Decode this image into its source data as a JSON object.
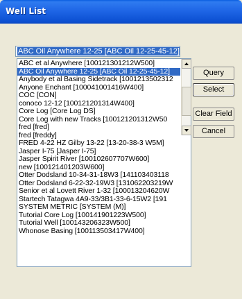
{
  "window": {
    "title": "Well List"
  },
  "selected_text": "ABC Oil Anywhere 12-25  [ABC Oil 12-25-45-12]",
  "list": {
    "items": [
      "ABC et al Anywhere  [100121301212W500]",
      "ABC Oil Anywhere 12-25  [ABC Oil 12-25-45-12]",
      "Anybody et al Basing Sidetrack  [1001213502312",
      "Anyone Enchant  [100041001416W400]",
      "COC  [CON]",
      "conoco 12-12  [100121201314W400]",
      "Core Log  [Core Log DS]",
      "Core Log with new Tracks  [100121201312W50",
      "fred  [fred]",
      "fred  [freddy]",
      "FRED 4-22 HZ Gilby 13-22  [13-20-38-3 W5M]",
      "Jasper I-75  [Jasper I-75]",
      "Jasper Spirit River  [100102607707W600]",
      "new  [100121401203W600]",
      "Otter Dodsland 10-34-31-18W3  [141103403118",
      "Otter Dodsland 6-22-32-19W3  [131062203219W",
      "Senior et al Lovett River 1-32  [100013204620W",
      "Startech Tatagwa 4A9-33/3B1-33-6-15W2  [191",
      "SYSTEM METRIC  [SYSTEM (M)]",
      "Tutorial Core Log  [100141901223W500]",
      "Tutorial Well  [100143206323W500]",
      "Whonose Basing  [100113503417W400]"
    ],
    "selected_index": 1
  },
  "buttons": {
    "query": "Query",
    "select": "Select",
    "clear_field": "Clear Field",
    "cancel": "Cancel"
  }
}
